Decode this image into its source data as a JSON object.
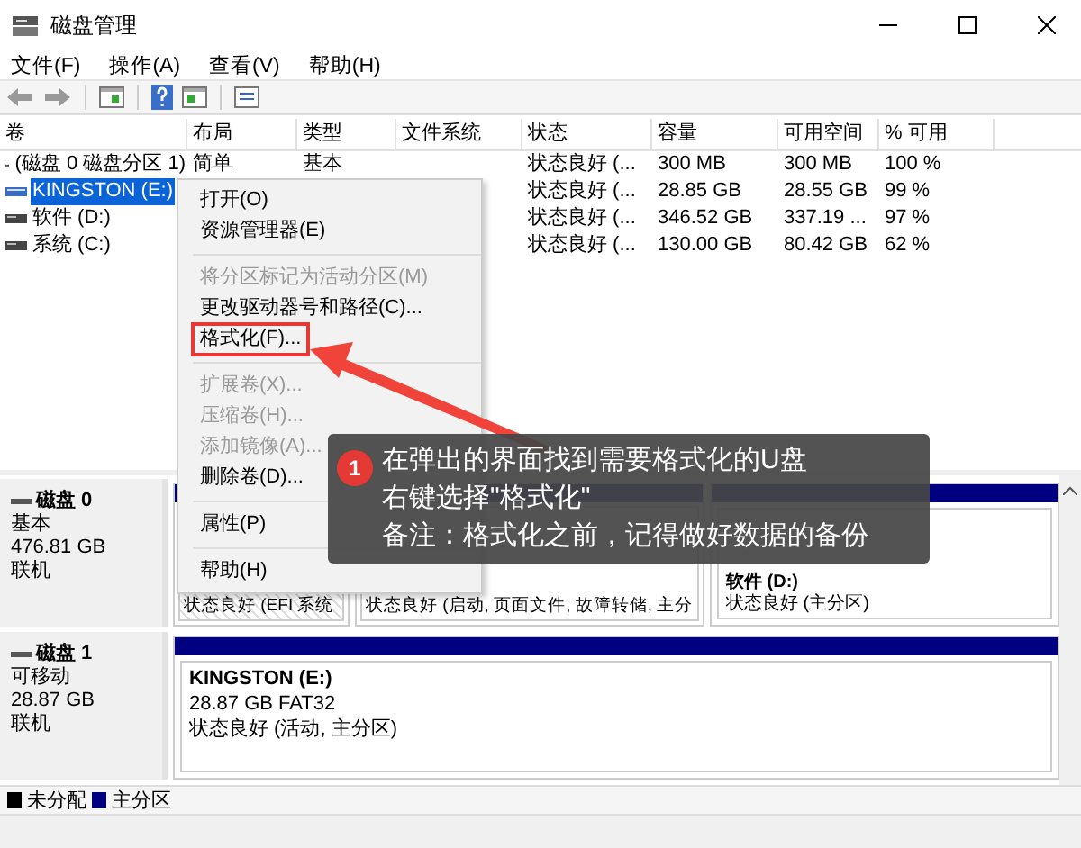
{
  "window": {
    "title": "磁盘管理"
  },
  "menu_bar": [
    "文件(F)",
    "操作(A)",
    "查看(V)",
    "帮助(H)"
  ],
  "volume_table": {
    "columns": [
      "卷",
      "布局",
      "类型",
      "文件系统",
      "状态",
      "容量",
      "可用空间",
      "% 可用"
    ],
    "rows": [
      {
        "kind": "fixed",
        "selected": false,
        "volume": "(磁盘 0 磁盘分区 1)",
        "layout": "简单",
        "type": "基本",
        "status": "状态良好 (...",
        "capacity": "300 MB",
        "free": "300 MB",
        "percent": "100 %"
      },
      {
        "kind": "removable",
        "selected": true,
        "volume": "KINGSTON (E:)",
        "status": "状态良好 (...",
        "capacity": "28.85 GB",
        "free": "28.55 GB",
        "percent": "99 %"
      },
      {
        "kind": "fixed",
        "selected": false,
        "volume": "软件 (D:)",
        "status": "状态良好 (...",
        "capacity": "346.52 GB",
        "free": "337.19 ...",
        "percent": "97 %"
      },
      {
        "kind": "fixed",
        "selected": false,
        "volume": "系统 (C:)",
        "status": "状态良好 (...",
        "capacity": "130.00 GB",
        "free": "80.42 GB",
        "percent": "62 %"
      }
    ]
  },
  "context_menu": {
    "items": [
      {
        "kind": "item",
        "label": "打开(O)",
        "disabled": false,
        "boxed": false
      },
      {
        "kind": "item",
        "label": "资源管理器(E)",
        "disabled": false,
        "boxed": false
      },
      {
        "kind": "separator"
      },
      {
        "kind": "item",
        "label": "将分区标记为活动分区(M)",
        "disabled": true,
        "boxed": false
      },
      {
        "kind": "item",
        "label": "更改驱动器号和路径(C)...",
        "disabled": false,
        "boxed": false
      },
      {
        "kind": "item",
        "label": "格式化(F)...",
        "disabled": false,
        "boxed": true
      },
      {
        "kind": "separator"
      },
      {
        "kind": "item",
        "label": "扩展卷(X)...",
        "disabled": true,
        "boxed": false
      },
      {
        "kind": "item",
        "label": "压缩卷(H)...",
        "disabled": true,
        "boxed": false
      },
      {
        "kind": "item",
        "label": "添加镜像(A)...",
        "disabled": true,
        "boxed": false
      },
      {
        "kind": "item",
        "label": "删除卷(D)...",
        "disabled": false,
        "boxed": false
      },
      {
        "kind": "separator"
      },
      {
        "kind": "item",
        "label": "属性(P)",
        "disabled": false,
        "boxed": false
      },
      {
        "kind": "separator"
      },
      {
        "kind": "item",
        "label": "帮助(H)",
        "disabled": false,
        "boxed": false
      }
    ]
  },
  "callout": {
    "step": "1",
    "lines": [
      "在弹出的界面找到需要格式化的U盘",
      "右键选择\"格式化\"",
      "备注：格式化之前，记得做好数据的备份"
    ]
  },
  "disks": [
    {
      "name": "磁盘 0",
      "type": "基本",
      "size": "476.81 GB",
      "status": "联机",
      "partitions": [
        {
          "kind": "efi",
          "details": [
            "状态良好 (EFI 系统"
          ]
        },
        {
          "kind": "primary",
          "details": [
            "状态良好 (启动, 页面文件, 故障转储, 主分"
          ]
        },
        {
          "kind": "primary",
          "title": "软件 (D:)",
          "details": [
            "状态良好 (主分区)"
          ]
        }
      ]
    },
    {
      "name": "磁盘 1",
      "type": "可移动",
      "size": "28.87 GB",
      "status": "联机",
      "partitions": [
        {
          "kind": "primary",
          "title": "KINGSTON  (E:)",
          "details": [
            "28.87 GB FAT32",
            "状态良好 (活动, 主分区)"
          ]
        }
      ]
    }
  ],
  "legend": [
    {
      "label": "未分配",
      "color": "#000000"
    },
    {
      "label": "主分区",
      "color": "#000080"
    }
  ]
}
